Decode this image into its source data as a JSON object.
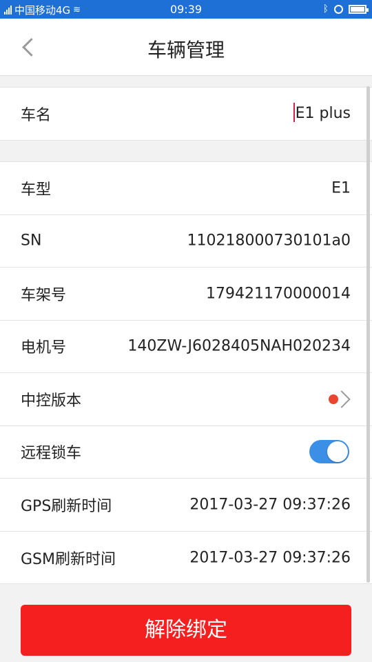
{
  "status_bar": {
    "carrier": "中国移动4G",
    "time": "09:39",
    "icons": [
      "signal-icon",
      "wifi-icon",
      "bluetooth-icon",
      "alarm-icon",
      "battery-icon"
    ]
  },
  "header": {
    "title": "车辆管理",
    "back_icon": "chevron-left-icon"
  },
  "vehicle_name": {
    "label": "车名",
    "value": "E1 plus"
  },
  "details": {
    "model": {
      "label": "车型",
      "value": "E1"
    },
    "sn": {
      "label": "SN",
      "value": "110218000730101a0"
    },
    "frame": {
      "label": "车架号",
      "value": "179421170000014"
    },
    "motor": {
      "label": "电机号",
      "value": "140ZW-J6028405NAH020234"
    },
    "firmware": {
      "label": "中控版本",
      "has_update_dot": true
    },
    "remote_lock": {
      "label": "远程锁车",
      "enabled": true
    },
    "gps_refresh": {
      "label": "GPS刷新时间",
      "value": "2017-03-27 09:37:26"
    },
    "gsm_refresh": {
      "label": "GSM刷新时间",
      "value": "2017-03-27 09:37:26"
    }
  },
  "actions": {
    "unbind_label": "解除绑定"
  },
  "colors": {
    "status_bar": "#1e6fd6",
    "toggle_on": "#3c8fe6",
    "update_dot": "#e9452f",
    "danger_button": "#f51f1f",
    "caret": "#d0204a"
  }
}
